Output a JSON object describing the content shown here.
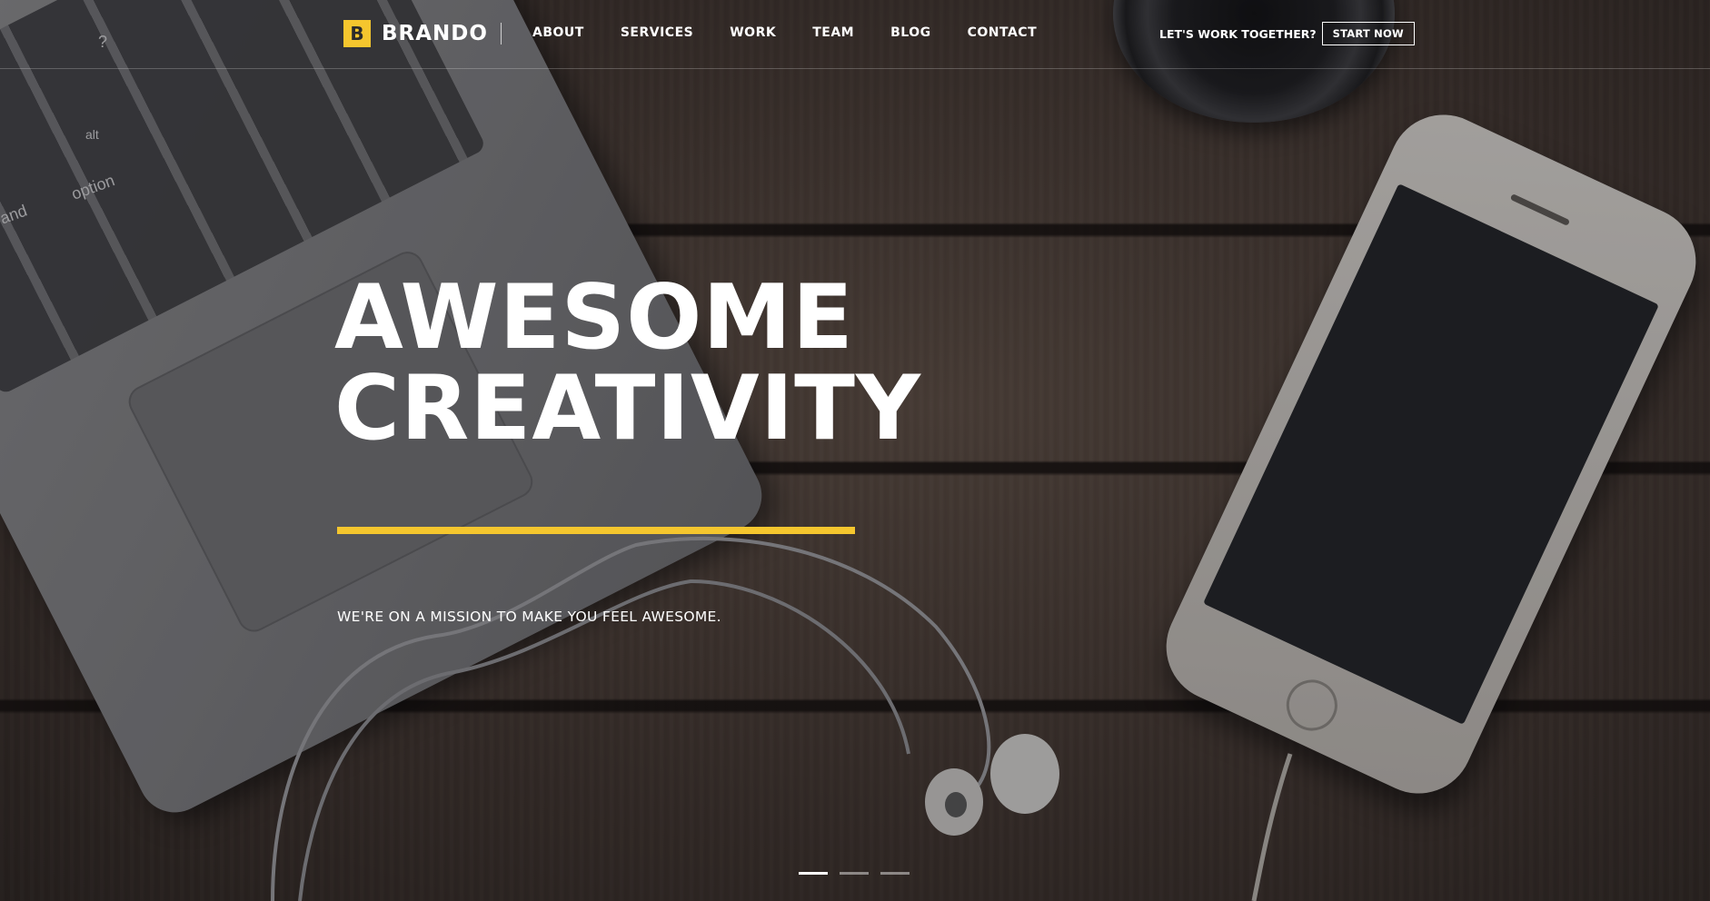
{
  "brand": {
    "mark": "B",
    "name": "BRANDO",
    "accent": "#f5c62e"
  },
  "nav": {
    "items": [
      {
        "label": "ABOUT"
      },
      {
        "label": "SERVICES"
      },
      {
        "label": "WORK"
      },
      {
        "label": "TEAM"
      },
      {
        "label": "BLOG"
      },
      {
        "label": "CONTACT"
      }
    ]
  },
  "header_cta": {
    "text": "LET'S WORK TOGETHER?",
    "button_label": "START NOW"
  },
  "hero": {
    "title_line1": "AWESOME",
    "title_line2": "CREATIVITY",
    "subtitle": "WE'RE ON A MISSION TO MAKE YOU FEEL AWESOME."
  },
  "laptop_keys": [
    "?",
    "alt",
    "option",
    "and"
  ],
  "slider": {
    "active_index": 0,
    "count": 3
  }
}
